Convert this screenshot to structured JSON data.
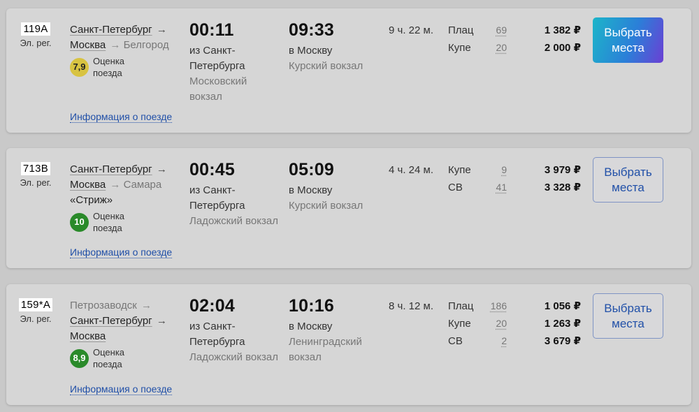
{
  "trains": [
    {
      "number": "119А",
      "type": "Эл. рег.",
      "route": [
        {
          "name": "Санкт-Петербург",
          "style": "main"
        },
        {
          "name": "Москва",
          "style": "main"
        },
        {
          "name": "Белгород",
          "style": "dim"
        }
      ],
      "brand": "",
      "rating": {
        "score": "7,9",
        "label_line1": "Оценка",
        "label_line2": "поезда",
        "color": "#d8c341"
      },
      "info_link": "Информация о поезде",
      "departure": {
        "time": "00:11",
        "place_line1": "из Санкт-",
        "place_line2": "Петербурга",
        "station_line1": "Московский",
        "station_line2": "вокзал"
      },
      "arrival": {
        "time": "09:33",
        "place_line1": "в Москву",
        "station_line1": "Курский вокзал",
        "station_line2": ""
      },
      "duration": "9 ч. 22 м.",
      "classes": [
        {
          "name": "Плац",
          "seats": "69",
          "price": "1 382 ₽"
        },
        {
          "name": "Купе",
          "seats": "20",
          "price": "2 000 ₽"
        }
      ],
      "button": {
        "line1": "Выбрать",
        "line2": "места",
        "style": "primary"
      }
    },
    {
      "number": "713В",
      "type": "Эл. рег.",
      "route": [
        {
          "name": "Санкт-Петербург",
          "style": "main"
        },
        {
          "name": "Москва",
          "style": "main"
        },
        {
          "name": "Самара",
          "style": "dim"
        }
      ],
      "brand": "«Стриж»",
      "rating": {
        "score": "10",
        "label_line1": "Оценка",
        "label_line2": "поезда",
        "color": "#2a8a2a"
      },
      "info_link": "Информация о поезде",
      "departure": {
        "time": "00:45",
        "place_line1": "из Санкт-",
        "place_line2": "Петербурга",
        "station_line1": "Ладожский вокзал",
        "station_line2": ""
      },
      "arrival": {
        "time": "05:09",
        "place_line1": "в Москву",
        "station_line1": "Курский вокзал",
        "station_line2": ""
      },
      "duration": "4 ч. 24 м.",
      "classes": [
        {
          "name": "Купе",
          "seats": "9",
          "price": "3 979 ₽"
        },
        {
          "name": "СВ",
          "seats": "41",
          "price": "3 328 ₽"
        }
      ],
      "button": {
        "line1": "Выбрать",
        "line2": "места",
        "style": "outline"
      }
    },
    {
      "number": "159*А",
      "type": "Эл. рег.",
      "route": [
        {
          "name": "Петрозаводск",
          "style": "dim"
        },
        {
          "name": "Санкт-Петербург",
          "style": "main"
        },
        {
          "name": "Москва",
          "style": "main"
        }
      ],
      "brand": "",
      "rating": {
        "score": "8,9",
        "label_line1": "Оценка",
        "label_line2": "поезда",
        "color": "#2a8a2a"
      },
      "info_link": "Информация о поезде",
      "departure": {
        "time": "02:04",
        "place_line1": "из Санкт-",
        "place_line2": "Петербурга",
        "station_line1": "Ладожский вокзал",
        "station_line2": ""
      },
      "arrival": {
        "time": "10:16",
        "place_line1": "в Москву",
        "station_line1": "Ленинградский",
        "station_line2": "вокзал"
      },
      "duration": "8 ч. 12 м.",
      "classes": [
        {
          "name": "Плац",
          "seats": "186",
          "price": "1 056 ₽"
        },
        {
          "name": "Купе",
          "seats": "20",
          "price": "1 263 ₽"
        },
        {
          "name": "СВ",
          "seats": "2",
          "price": "3 679 ₽"
        }
      ],
      "button": {
        "line1": "Выбрать",
        "line2": "места",
        "style": "outline"
      }
    }
  ]
}
